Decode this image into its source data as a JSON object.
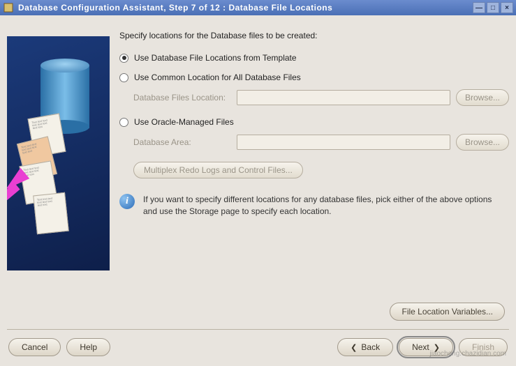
{
  "window": {
    "title": "Database Configuration Assistant, Step 7 of 12 : Database File Locations"
  },
  "heading": "Specify locations for the Database files to be created:",
  "options": {
    "template": "Use Database File Locations from Template",
    "common": "Use Common Location for All Database Files",
    "common_field_label": "Database Files Location:",
    "omf": "Use Oracle-Managed Files",
    "omf_field_label": "Database Area:",
    "browse": "Browse...",
    "multiplex": "Multiplex Redo Logs and Control Files...",
    "selected": "template"
  },
  "info": "If you want to specify different locations for any database files, pick either of the above options and use the Storage page to specify each location.",
  "file_location_variables": "File Location Variables...",
  "footer": {
    "cancel": "Cancel",
    "help": "Help",
    "back": "Back",
    "next": "Next",
    "finish": "Finish"
  },
  "watermark": "jiaocheng.chazidian.com"
}
